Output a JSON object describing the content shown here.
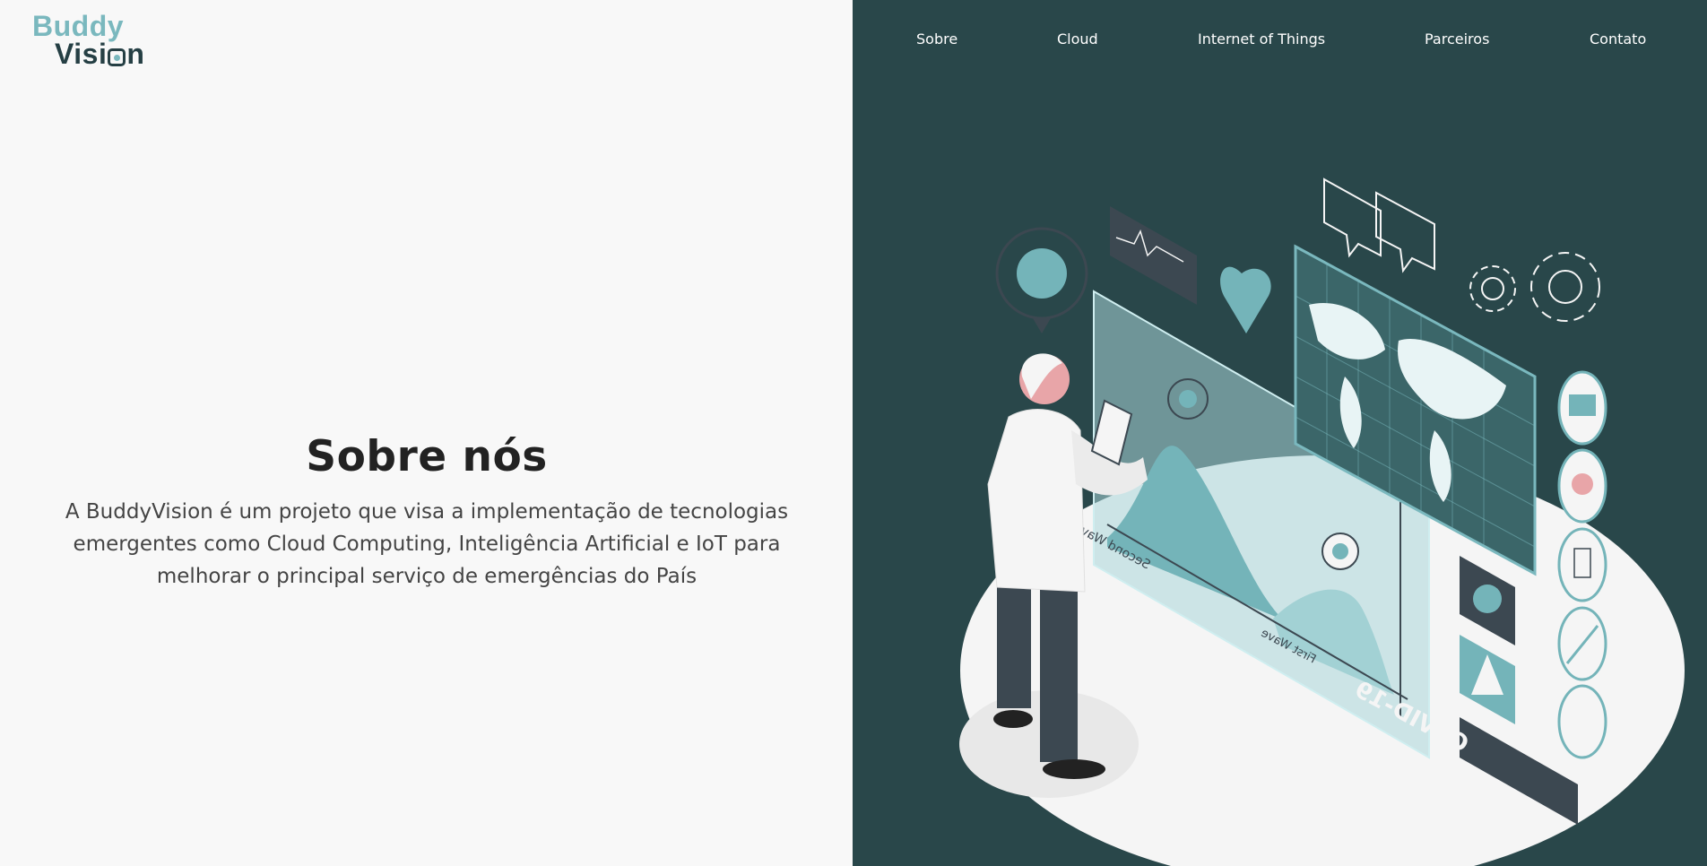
{
  "logo": {
    "line1": "Buddy",
    "line2_prefix": "Visi",
    "line2_suffix": "n"
  },
  "nav": [
    {
      "label": "Sobre"
    },
    {
      "label": "Cloud"
    },
    {
      "label": "Internet of Things"
    },
    {
      "label": "Parceiros"
    },
    {
      "label": "Contato"
    }
  ],
  "about": {
    "title": "Sobre nós",
    "description": "A BuddyVision é um projeto que visa a implementação de tecnologias emergentes como Cloud Computing, Inteligência Artificial e IoT para melhorar o principal serviço de emergências do País"
  },
  "illustration": {
    "labels": {
      "second_wave": "Second Wave",
      "first_wave": "First Wave",
      "covid": "COVID-19"
    },
    "colors": {
      "bg": "#29474a",
      "accent": "#7ab8be",
      "dark": "#3c4851",
      "light": "#f5f5f5"
    }
  }
}
